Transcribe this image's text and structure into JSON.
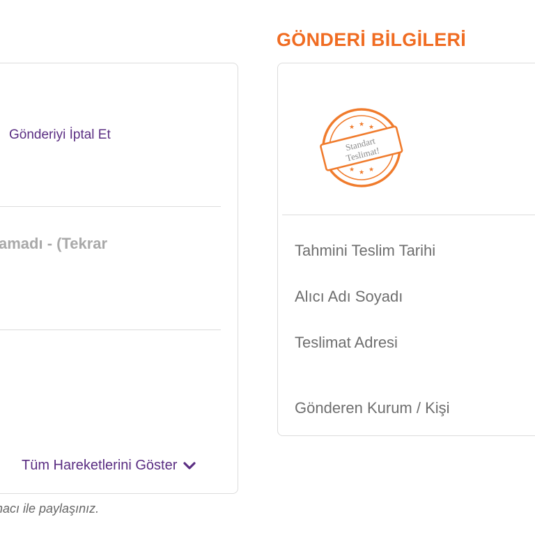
{
  "tracking_panel": {
    "cancel_link": "Gönderiyi İptal Et",
    "status_text": "amadı - (Tekrar",
    "show_all_link": "Tüm Hareketlerini Göster",
    "footer_note": "nacı ile paylaşınız."
  },
  "shipment_info": {
    "title": "GÖNDERİ BİLGİLERİ",
    "stamp": {
      "line1": "Standart",
      "line2": "Teslimat!",
      "color": "#f07b2c"
    },
    "labels": [
      "Tahmini Teslim Tarihi",
      "Alıcı Adı Soyadı",
      "Teslimat Adresi",
      "Gönderen Kurum / Kişi"
    ]
  },
  "colors": {
    "accent_orange": "#f06c22",
    "link_purple": "#5a2d82",
    "muted_text": "#a9a9a9",
    "label_text": "#6e6e6e",
    "border": "#dcdcdc"
  }
}
